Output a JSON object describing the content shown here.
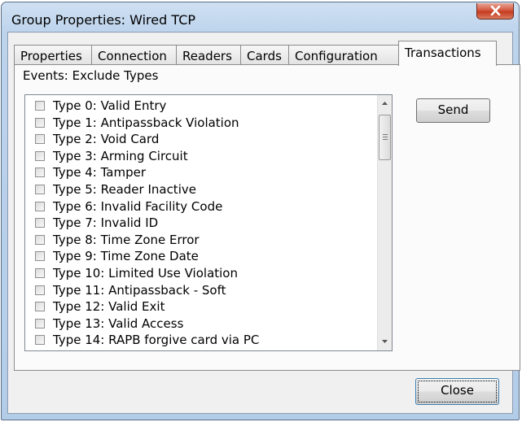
{
  "window": {
    "title": "Group Properties: Wired TCP"
  },
  "tabs": [
    {
      "label": "Properties"
    },
    {
      "label": "Connection"
    },
    {
      "label": "Readers"
    },
    {
      "label": "Cards"
    },
    {
      "label": "Configuration"
    },
    {
      "label": "Transactions",
      "active": true
    }
  ],
  "events": {
    "group_label": "Events: Exclude Types",
    "items": [
      {
        "label": "Type 0: Valid Entry",
        "checked": false
      },
      {
        "label": "Type 1: Antipassback Violation",
        "checked": false
      },
      {
        "label": "Type 2: Void Card",
        "checked": false
      },
      {
        "label": "Type 3: Arming Circuit",
        "checked": false
      },
      {
        "label": "Type 4: Tamper",
        "checked": false
      },
      {
        "label": "Type 5: Reader Inactive",
        "checked": false
      },
      {
        "label": "Type 6: Invalid Facility Code",
        "checked": false
      },
      {
        "label": "Type 7: Invalid ID",
        "checked": false
      },
      {
        "label": "Type 8: Time Zone Error",
        "checked": false
      },
      {
        "label": "Type 9: Time Zone Date",
        "checked": false
      },
      {
        "label": "Type 10: Limited Use Violation",
        "checked": false
      },
      {
        "label": "Type 11: Antipassback - Soft",
        "checked": false
      },
      {
        "label": "Type 12: Valid Exit",
        "checked": false
      },
      {
        "label": "Type 13: Valid Access",
        "checked": false
      },
      {
        "label": "Type 14: RAPB forgive card via PC",
        "checked": false
      }
    ]
  },
  "buttons": {
    "send": "Send",
    "close": "Close"
  },
  "icons": {
    "close_window": "close-icon",
    "scroll_up": "scroll-up-arrow-icon",
    "scroll_down": "scroll-down-arrow-icon"
  },
  "colors": {
    "title_bar": "#b9d1ea",
    "close_button": "#c9472d",
    "panel": "#fbfbfb"
  }
}
